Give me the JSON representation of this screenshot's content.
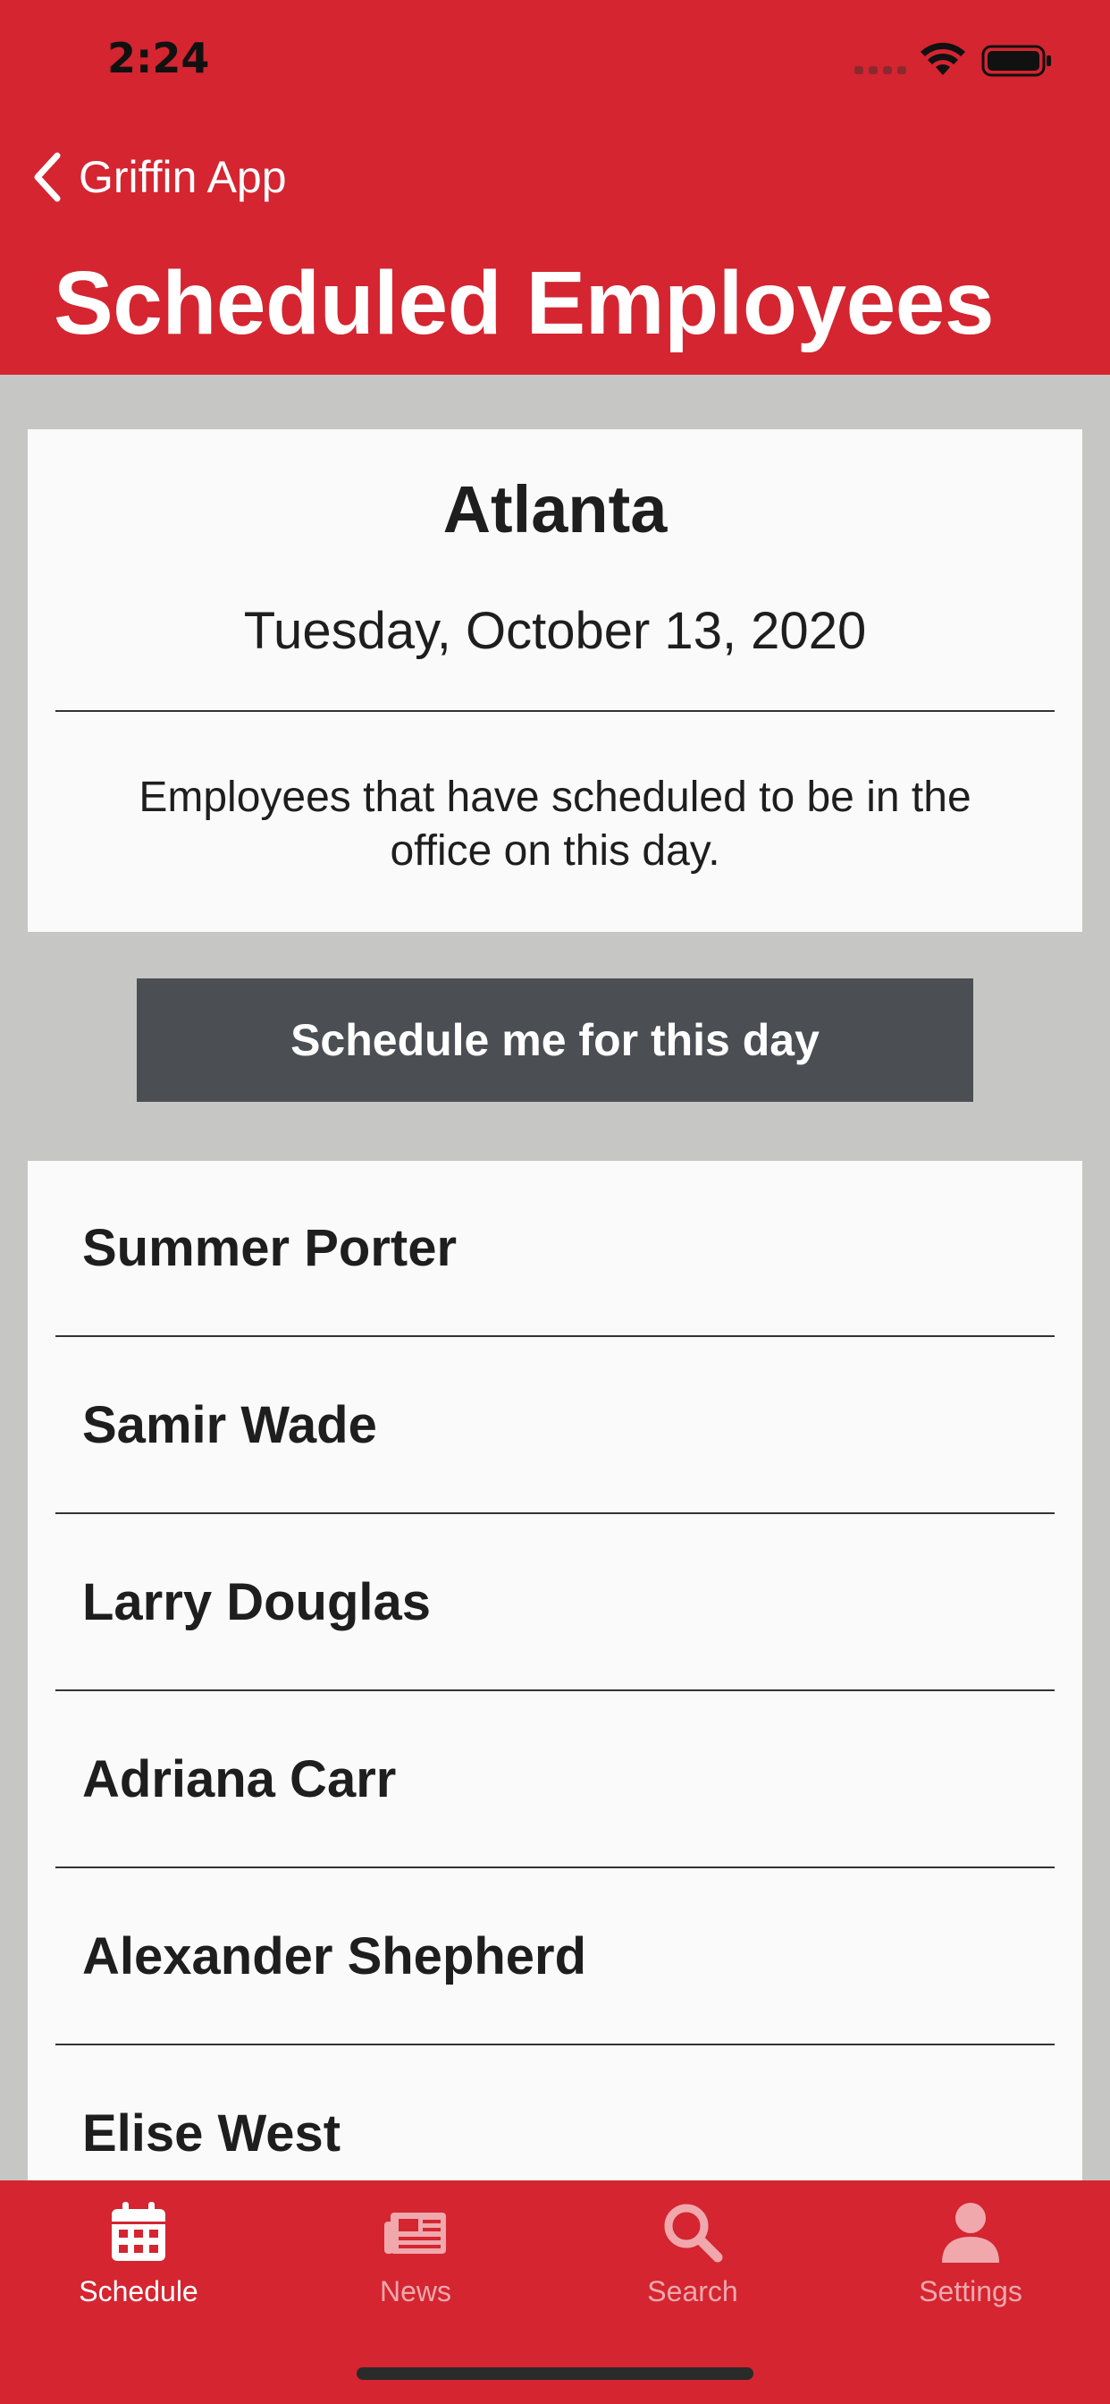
{
  "status_bar": {
    "time": "2:24"
  },
  "nav": {
    "back_label": "Griffin App",
    "title": "Scheduled Employees"
  },
  "info": {
    "city": "Atlanta",
    "date": "Tuesday, October 13, 2020",
    "description": "Employees that have scheduled to be in the office on this day."
  },
  "action": {
    "schedule_label": "Schedule me for this day"
  },
  "employees": [
    "Summer Porter",
    "Samir Wade",
    "Larry Douglas",
    "Adriana Carr",
    "Alexander Shepherd",
    "Elise West"
  ],
  "tabs": [
    {
      "label": "Schedule",
      "icon": "calendar-icon",
      "active": true
    },
    {
      "label": "News",
      "icon": "newspaper-icon",
      "active": false
    },
    {
      "label": "Search",
      "icon": "search-icon",
      "active": false
    },
    {
      "label": "Settings",
      "icon": "user-icon",
      "active": false
    }
  ],
  "colors": {
    "brand_red": "#d42530",
    "button_gray": "#4b4f54",
    "background": "#c6c6c5",
    "card": "#fafafa"
  }
}
